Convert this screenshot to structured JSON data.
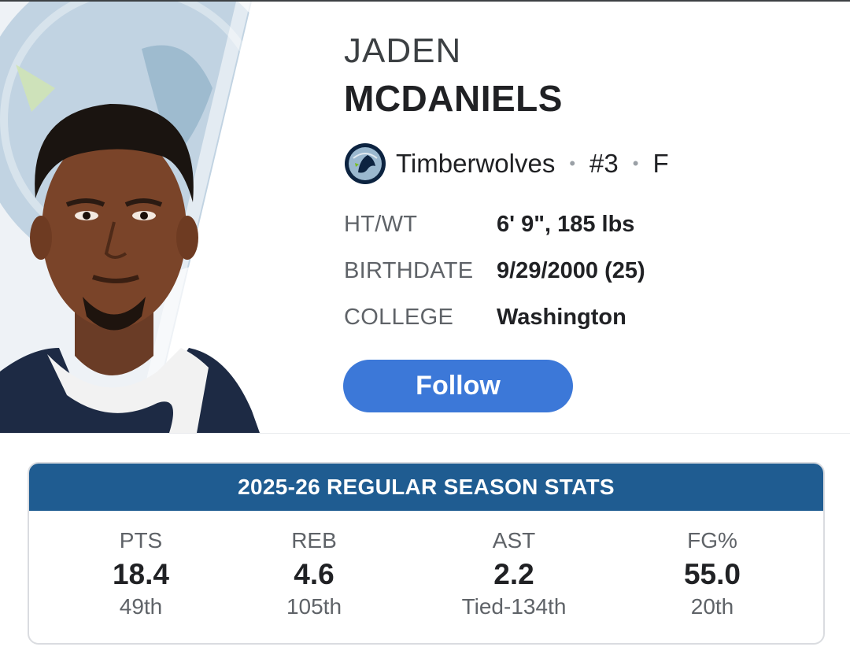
{
  "player": {
    "first_name": "JADEN",
    "last_name": "MCDANIELS",
    "team": "Timberwolves",
    "number": "#3",
    "position": "F"
  },
  "info": [
    {
      "label": "HT/WT",
      "value": "6' 9\", 185 lbs"
    },
    {
      "label": "BIRTHDATE",
      "value": "9/29/2000 (25)"
    },
    {
      "label": "COLLEGE",
      "value": "Washington"
    }
  ],
  "follow_label": "Follow",
  "stats": {
    "title": "2025-26 REGULAR SEASON STATS",
    "items": [
      {
        "label": "PTS",
        "value": "18.4",
        "rank": "49th"
      },
      {
        "label": "REB",
        "value": "4.6",
        "rank": "105th"
      },
      {
        "label": "AST",
        "value": "2.2",
        "rank": "Tied-134th"
      },
      {
        "label": "FG%",
        "value": "55.0",
        "rank": "20th"
      }
    ]
  },
  "colors": {
    "accent_button": "#3c78d8",
    "stats_header": "#1f5c91",
    "team_navy": "#0c2340",
    "team_light_blue": "#9ab8cf"
  },
  "icons": {
    "team_logo": "timberwolves-logo-icon",
    "portrait": "player-headshot"
  }
}
